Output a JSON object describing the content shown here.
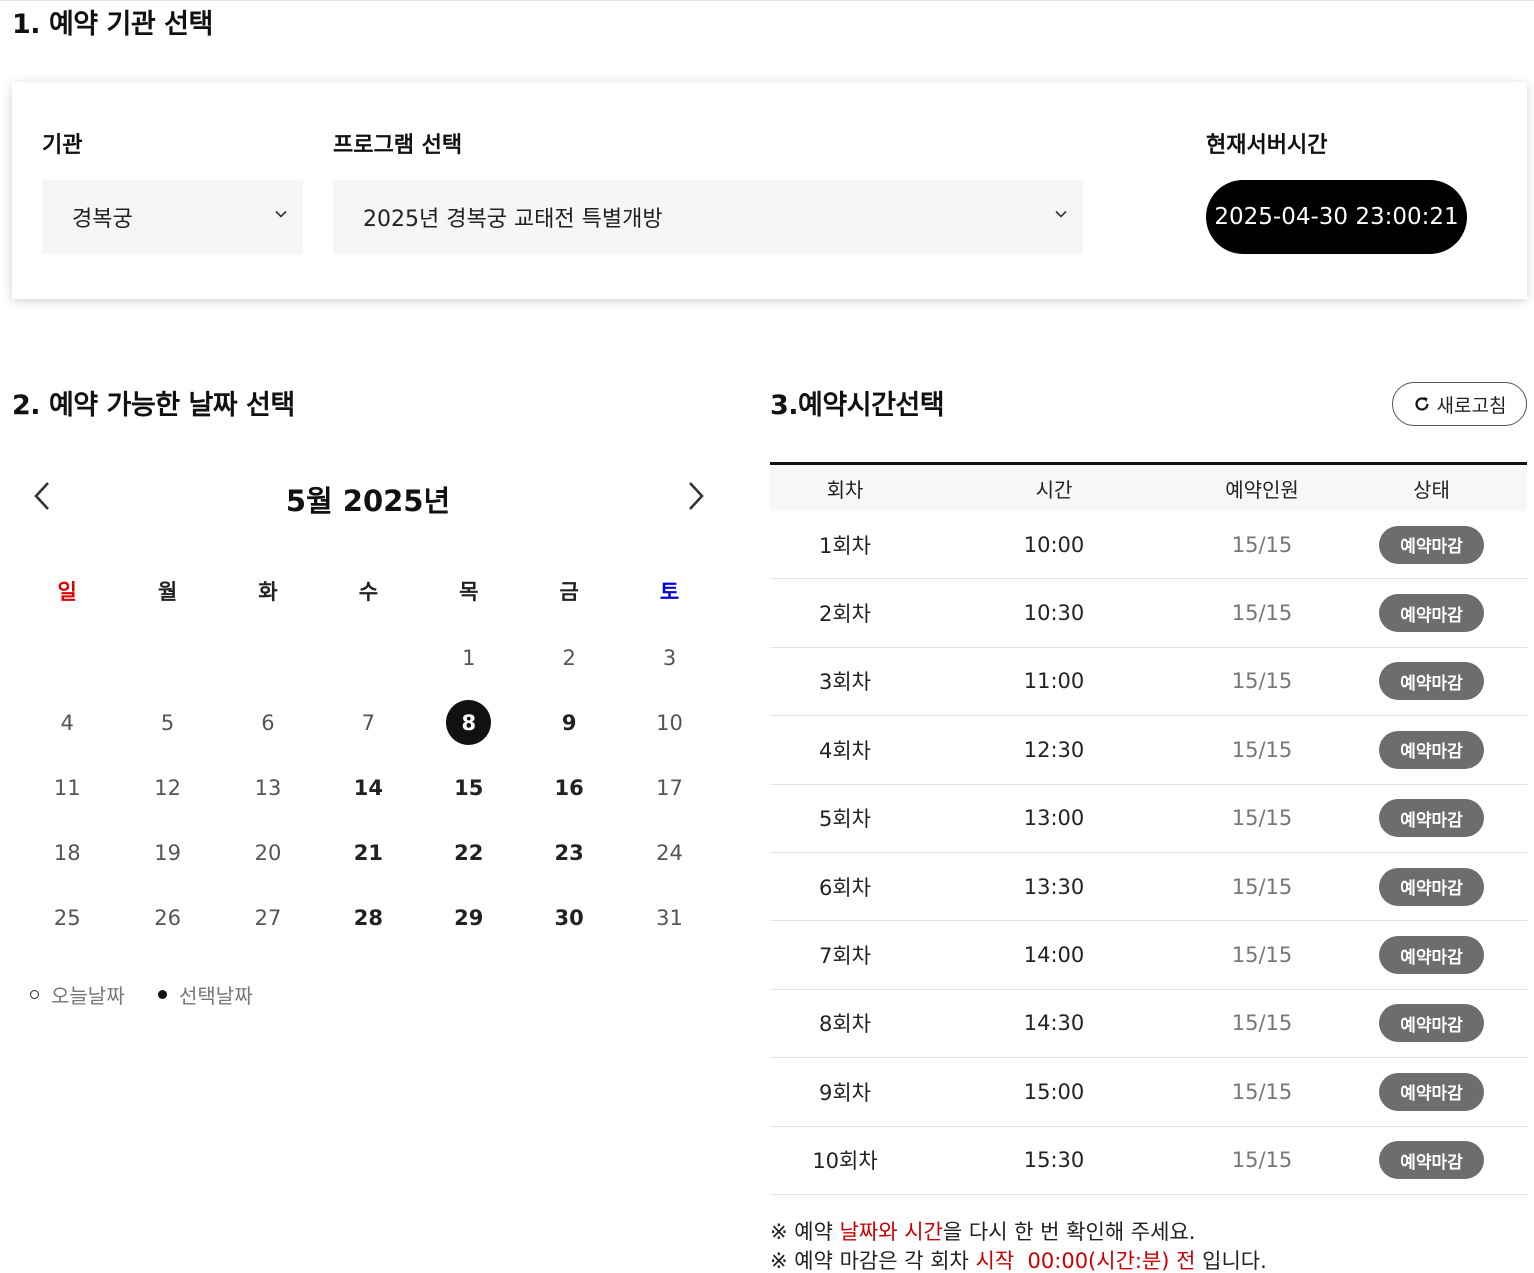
{
  "section1": {
    "title": "1. 예약 기관 선택",
    "institution_label": "기관",
    "institution_value": "경복궁",
    "program_label": "프로그램 선택",
    "program_value": "2025년 경복궁 교태전 특별개방",
    "server_time_label": "현재서버시간",
    "server_time_value": "2025-04-30 23:00:21"
  },
  "section2": {
    "title": "2. 예약 가능한 날짜 선택",
    "month_title": "5월 2025년",
    "weekdays": [
      "일",
      "월",
      "화",
      "수",
      "목",
      "금",
      "토"
    ],
    "weeks": [
      [
        "",
        "",
        "",
        "",
        "1",
        "2",
        "3"
      ],
      [
        "4",
        "5",
        "6",
        "7",
        "8",
        "9",
        "10"
      ],
      [
        "11",
        "12",
        "13",
        "14",
        "15",
        "16",
        "17"
      ],
      [
        "18",
        "19",
        "20",
        "21",
        "22",
        "23",
        "24"
      ],
      [
        "25",
        "26",
        "27",
        "28",
        "29",
        "30",
        "31"
      ]
    ],
    "available_days": [
      "8",
      "9",
      "14",
      "15",
      "16",
      "21",
      "22",
      "23",
      "28",
      "29",
      "30"
    ],
    "selected_day": "8",
    "legend_today": "오늘날짜",
    "legend_selected": "선택날짜"
  },
  "section3": {
    "title": "3.예약시간선택",
    "refresh_label": "새로고침",
    "columns": [
      "회차",
      "시간",
      "예약인원",
      "상태"
    ],
    "rows": [
      {
        "round": "1회차",
        "time": "10:00",
        "count": "15/15",
        "status": "예약마감"
      },
      {
        "round": "2회차",
        "time": "10:30",
        "count": "15/15",
        "status": "예약마감"
      },
      {
        "round": "3회차",
        "time": "11:00",
        "count": "15/15",
        "status": "예약마감"
      },
      {
        "round": "4회차",
        "time": "12:30",
        "count": "15/15",
        "status": "예약마감"
      },
      {
        "round": "5회차",
        "time": "13:00",
        "count": "15/15",
        "status": "예약마감"
      },
      {
        "round": "6회차",
        "time": "13:30",
        "count": "15/15",
        "status": "예약마감"
      },
      {
        "round": "7회차",
        "time": "14:00",
        "count": "15/15",
        "status": "예약마감"
      },
      {
        "round": "8회차",
        "time": "14:30",
        "count": "15/15",
        "status": "예약마감"
      },
      {
        "round": "9회차",
        "time": "15:00",
        "count": "15/15",
        "status": "예약마감"
      },
      {
        "round": "10회차",
        "time": "15:30",
        "count": "15/15",
        "status": "예약마감"
      }
    ],
    "note1_a": "※ 예약 ",
    "note1_b": "날짜와 시간",
    "note1_c": "을 다시 한 번 확인해 주세요.",
    "note2_a": "※ 예약 마감은 각 회차 ",
    "note2_b": "시작  00:00(시간:분) 전",
    "note2_c": " 입니다."
  },
  "colors": {
    "sunday": "#e00000",
    "saturday": "#0000e0",
    "accent_red": "#cc0000",
    "status_badge": "#6d6d6d"
  }
}
